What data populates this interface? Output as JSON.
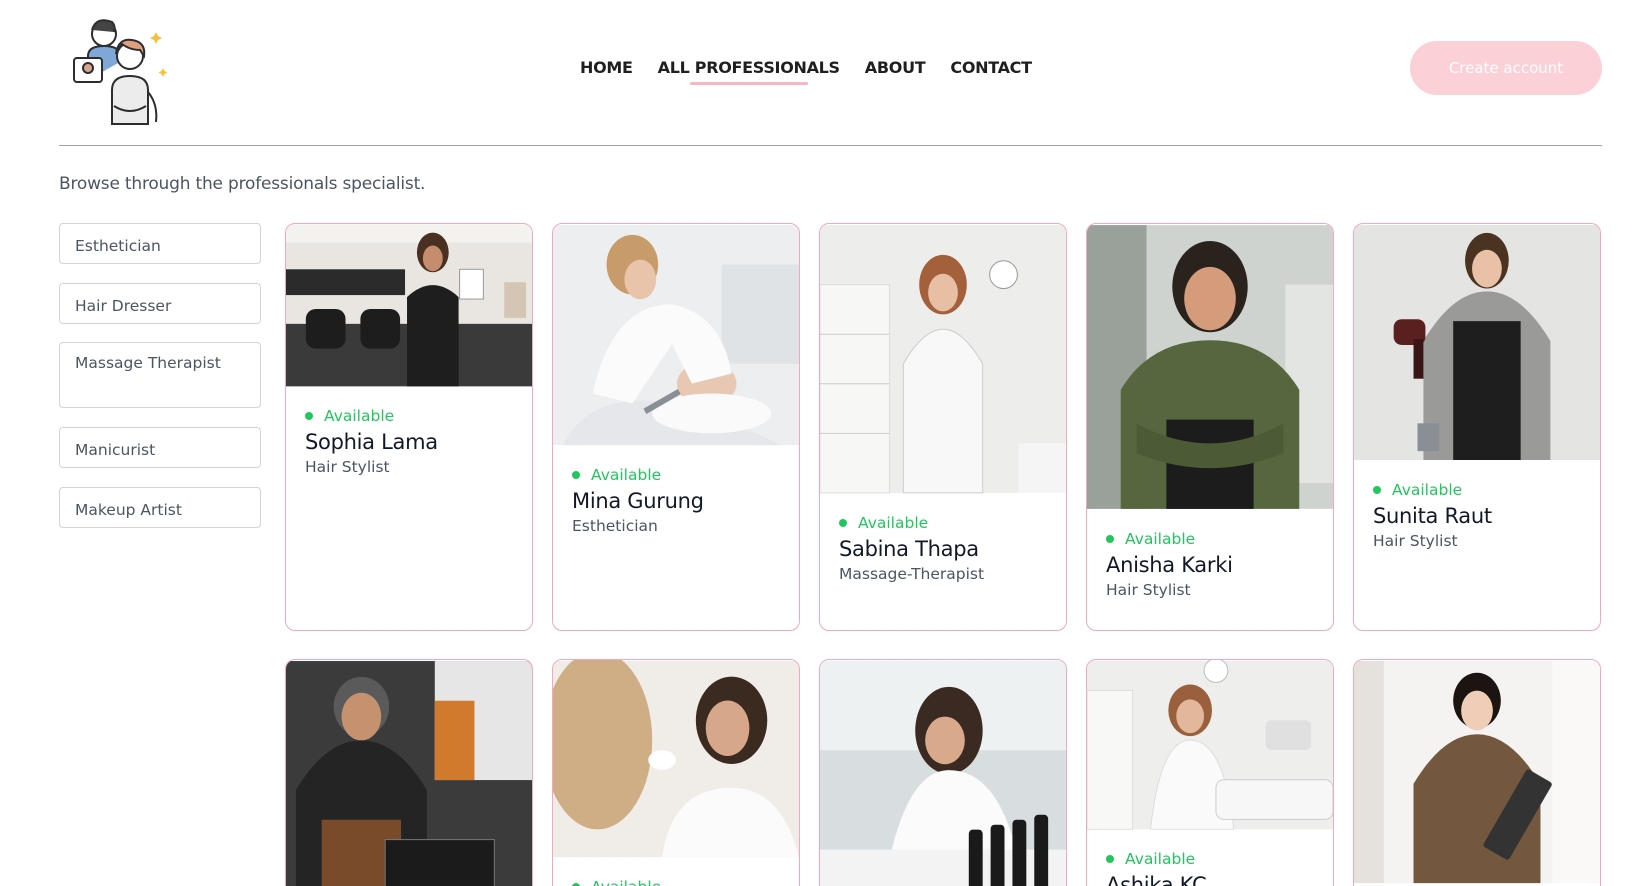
{
  "nav": {
    "items": [
      "HOME",
      "ALL PROFESSIONALS",
      "ABOUT",
      "CONTACT"
    ],
    "active": "ALL PROFESSIONALS"
  },
  "header": {
    "cta_label": "Create account"
  },
  "intro": "Browse through the professionals specialist.",
  "filters": [
    "Esthetician",
    "Hair Dresser",
    "Massage Therapist",
    "Manicurist",
    "Makeup Artist"
  ],
  "colors": {
    "accent": "#f6b7c3",
    "cta": "#fbd0d7",
    "available": "#22c55e",
    "card_border": "#f2a7c3"
  },
  "professionals": [
    {
      "name": "Sophia Lama",
      "role": "Hair Stylist",
      "status": "Available"
    },
    {
      "name": "Mina Gurung",
      "role": "Esthetician",
      "status": "Available"
    },
    {
      "name": "Sabina Thapa",
      "role": "Massage-Therapist",
      "status": "Available"
    },
    {
      "name": "Anisha Karki",
      "role": "Hair Stylist",
      "status": "Available"
    },
    {
      "name": "Sunita Raut",
      "role": "Hair Stylist",
      "status": "Available"
    },
    {
      "name": "",
      "role": "",
      "status": ""
    },
    {
      "name": "",
      "role": "",
      "status": "Available"
    },
    {
      "name": "",
      "role": "",
      "status": ""
    },
    {
      "name": "Ashika KC",
      "role": "",
      "status": "Available"
    },
    {
      "name": "",
      "role": "",
      "status": ""
    }
  ]
}
